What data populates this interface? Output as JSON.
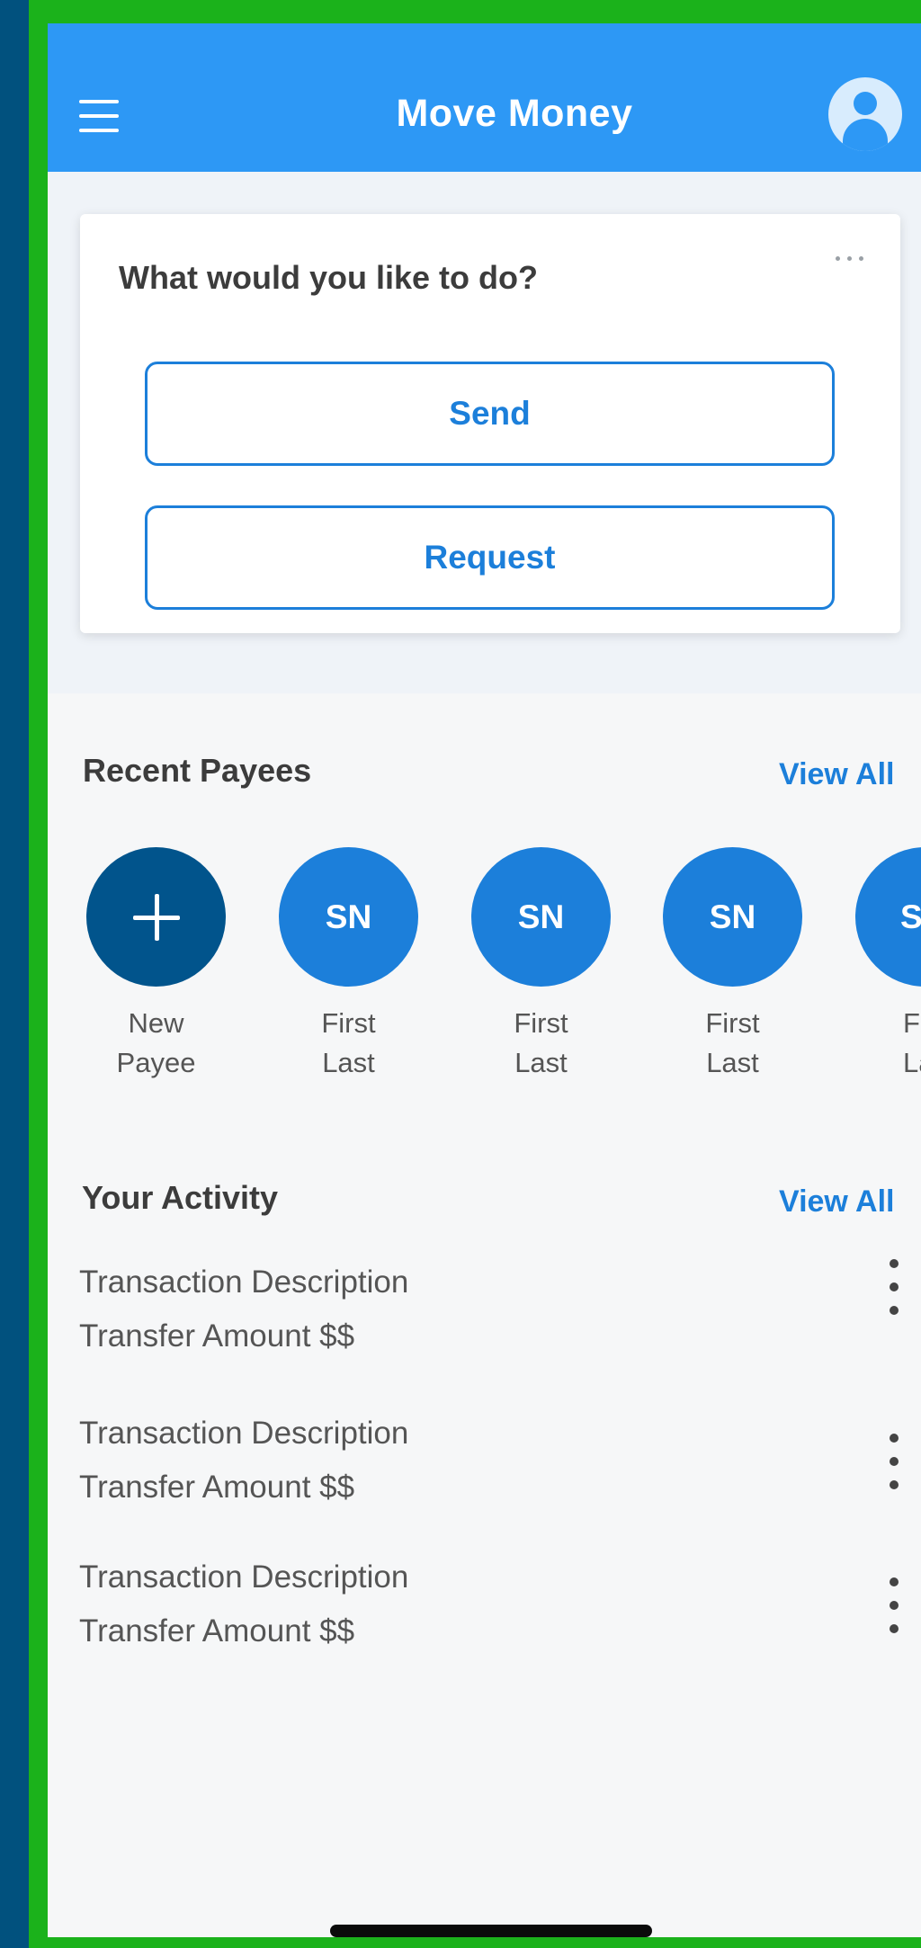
{
  "header": {
    "title": "Move Money",
    "menu_icon": "hamburger-menu-icon",
    "avatar_icon": "user-avatar-icon"
  },
  "action_card": {
    "question": "What would you like to do?",
    "send_label": "Send",
    "request_label": "Request"
  },
  "recent_payees": {
    "title": "Recent Payees",
    "view_all": "View All",
    "new_payee": {
      "line1": "New",
      "line2": "Payee"
    },
    "items": [
      {
        "initials": "SN",
        "first": "First",
        "last": "Last"
      },
      {
        "initials": "SN",
        "first": "First",
        "last": "Last"
      },
      {
        "initials": "SN",
        "first": "First",
        "last": "Last"
      },
      {
        "initials": "SN",
        "first": "First",
        "last": "Last"
      }
    ]
  },
  "activity": {
    "title": "Your Activity",
    "view_all": "View All",
    "items": [
      {
        "description": "Transaction Description",
        "amount": "Transfer Amount $$"
      },
      {
        "description": "Transaction Description",
        "amount": "Transfer Amount $$"
      },
      {
        "description": "Transaction Description",
        "amount": "Transfer Amount $$"
      }
    ]
  },
  "colors": {
    "header_blue": "#2d98f5",
    "primary_blue": "#1c7fda",
    "dark_blue": "#01548c",
    "frame_green": "#1bb21b",
    "outer_blue": "#01517e"
  }
}
